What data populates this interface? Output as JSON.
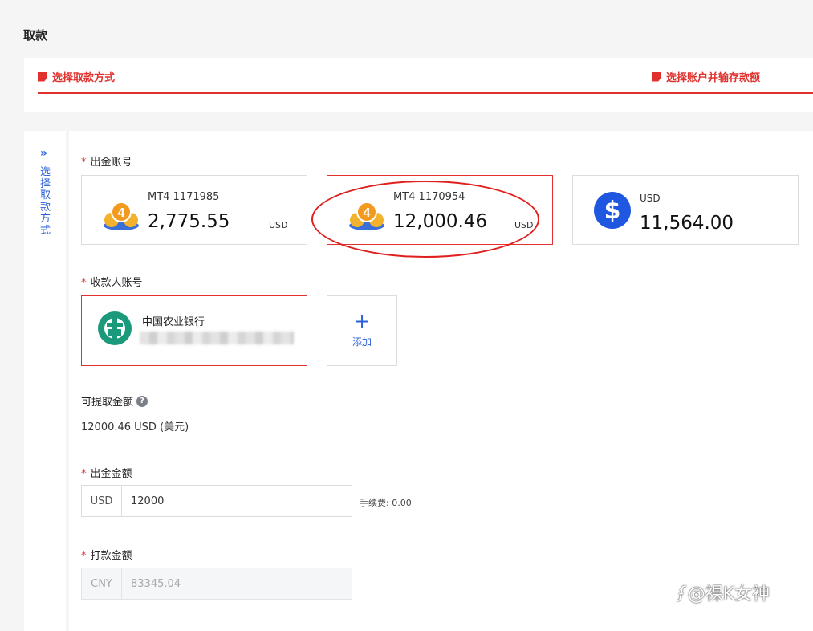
{
  "page": {
    "title": "取款"
  },
  "steps": [
    {
      "label": "选择取款方式"
    },
    {
      "label": "选择账户并输存款额"
    }
  ],
  "sidebar": {
    "toggle_icon": "double-chevron-right-icon",
    "label": "选择取款方式"
  },
  "withdraw_account": {
    "label": "出金账号",
    "cards": [
      {
        "name": "MT4 1171985",
        "balance": "2,775.55",
        "currency": "USD",
        "selected": false
      },
      {
        "name": "MT4 1170954",
        "balance": "12,000.46",
        "currency": "USD",
        "selected": true
      },
      {
        "label": "USD",
        "amount": "11,564.00",
        "icon": "dollar-icon"
      }
    ]
  },
  "payee_account": {
    "label": "收款人账号",
    "bank": {
      "name": "中国农业银行",
      "icon": "abc-bank-icon"
    },
    "add_label": "添加"
  },
  "withdrawable": {
    "label": "可提取金额",
    "value": "12000.46 USD (美元)"
  },
  "withdraw_amount": {
    "label": "出金金额",
    "currency": "USD",
    "value": "12000",
    "fee": "手续费: 0.00"
  },
  "pay_amount": {
    "label": "打款金额",
    "currency": "CNY",
    "value": "83345.04"
  },
  "watermark": {
    "text": "@裸K女神"
  },
  "colors": {
    "accent_red": "#e0312e",
    "link_blue": "#2b5fd9",
    "dollar_blue": "#1f57e0"
  }
}
